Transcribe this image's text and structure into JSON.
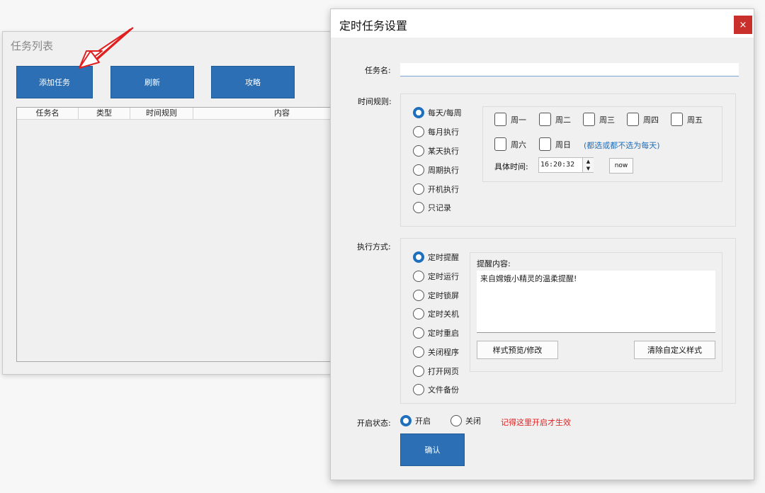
{
  "task_list": {
    "title": "任务列表",
    "buttons": {
      "add": "添加任务",
      "refresh": "刷新",
      "guide": "攻略"
    },
    "columns": [
      "任务名",
      "类型",
      "时间规则",
      "内容"
    ]
  },
  "dialog": {
    "title": "定时任务设置",
    "close_icon": "×",
    "task_name_label": "任务名:",
    "task_name_value": "",
    "time_rule_label": "时间规则:",
    "time_rules": [
      "每天/每周",
      "每月执行",
      "某天执行",
      "周期执行",
      "开机执行",
      "只记录"
    ],
    "weekdays": [
      "周一",
      "周二",
      "周三",
      "周四",
      "周五",
      "周六",
      "周日"
    ],
    "weekday_hint": "(都选或都不选为每天)",
    "specific_time_label": "具体时间:",
    "specific_time_value": "16:20:32",
    "now_button": "now",
    "exec_label": "执行方式:",
    "exec_modes": [
      "定时提醒",
      "定时运行",
      "定时锁屏",
      "定时关机",
      "定时重启",
      "关闭程序",
      "打开网页",
      "文件备份"
    ],
    "reminder_label": "提醒内容:",
    "reminder_text": "来自嫦娥小精灵的温柔提醒!",
    "style_preview_button": "样式预览/修改",
    "clear_style_button": "清除自定义样式",
    "status_label": "开启状态:",
    "status_on": "开启",
    "status_off": "关闭",
    "status_hint": "记得这里开启才生效",
    "confirm_button": "确认"
  },
  "colors": {
    "accent": "#2c6fb4",
    "close": "#c9302c",
    "hint_red": "#e02020",
    "hint_blue": "#1f6fbf"
  }
}
